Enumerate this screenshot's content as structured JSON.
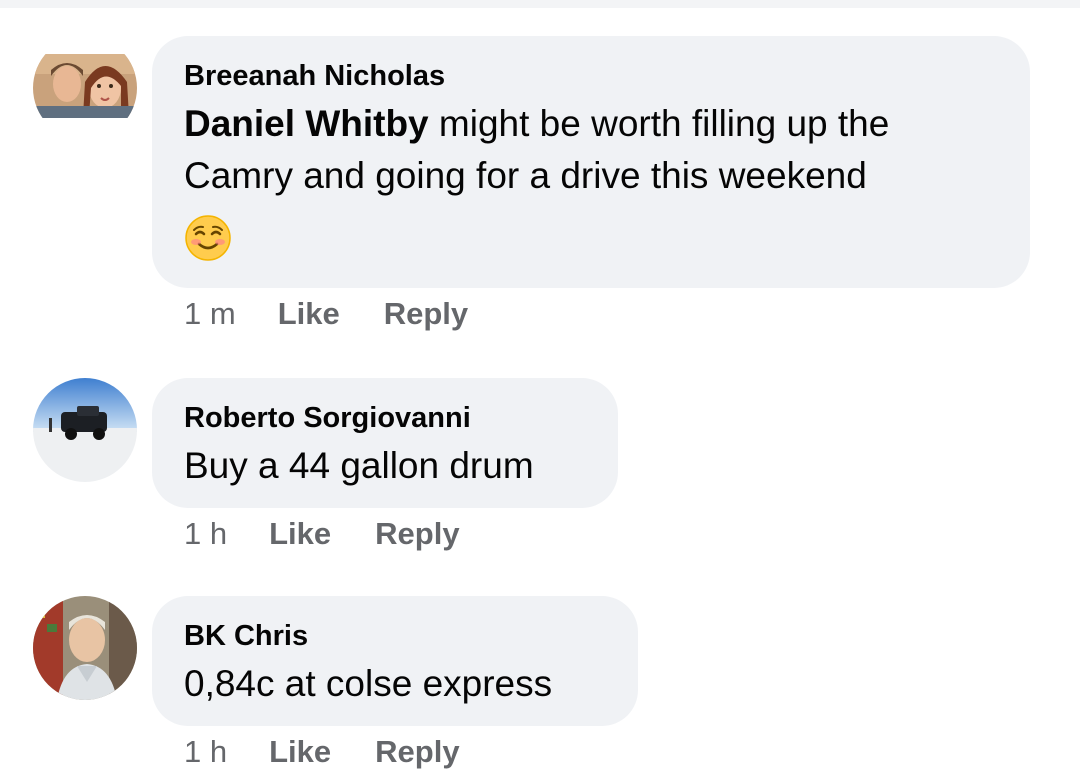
{
  "comments": [
    {
      "author": "Breeanah Nicholas",
      "mention": "Daniel Whitby",
      "text": " might be worth filling up the Camry and going for a drive this weekend",
      "emoji": "smiling-face-icon",
      "time": "1 m",
      "like_label": "Like",
      "reply_label": "Reply"
    },
    {
      "author": "Roberto Sorgiovanni",
      "text": "Buy a 44 gallon drum",
      "time": "1 h",
      "like_label": "Like",
      "reply_label": "Reply"
    },
    {
      "author": "BK Chris",
      "text": "0,84c at colse express",
      "time": "1 h",
      "like_label": "Like",
      "reply_label": "Reply"
    }
  ],
  "colors": {
    "bubble": "#f0f2f5",
    "meta_text": "#65676b",
    "text": "#050505"
  }
}
